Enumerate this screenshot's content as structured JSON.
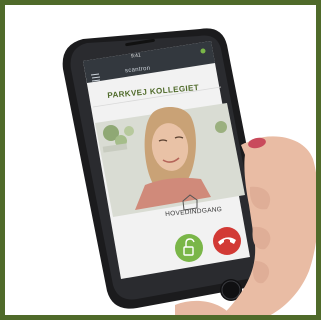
{
  "status_bar": {
    "time": "9:41"
  },
  "app": {
    "brand": "scantron"
  },
  "header": {
    "title": "PARKVEJ KOLLEGIET"
  },
  "call": {
    "location_label": "HOVEDINDGANG"
  },
  "colors": {
    "frame": "#4f6a2a",
    "accept": "#7ab648",
    "decline": "#d23a35",
    "title": "#4f6a2a"
  },
  "icons": {
    "accept": "unlock-icon",
    "decline": "phone-hangup-icon",
    "location": "home-icon",
    "menu": "menu-icon"
  }
}
